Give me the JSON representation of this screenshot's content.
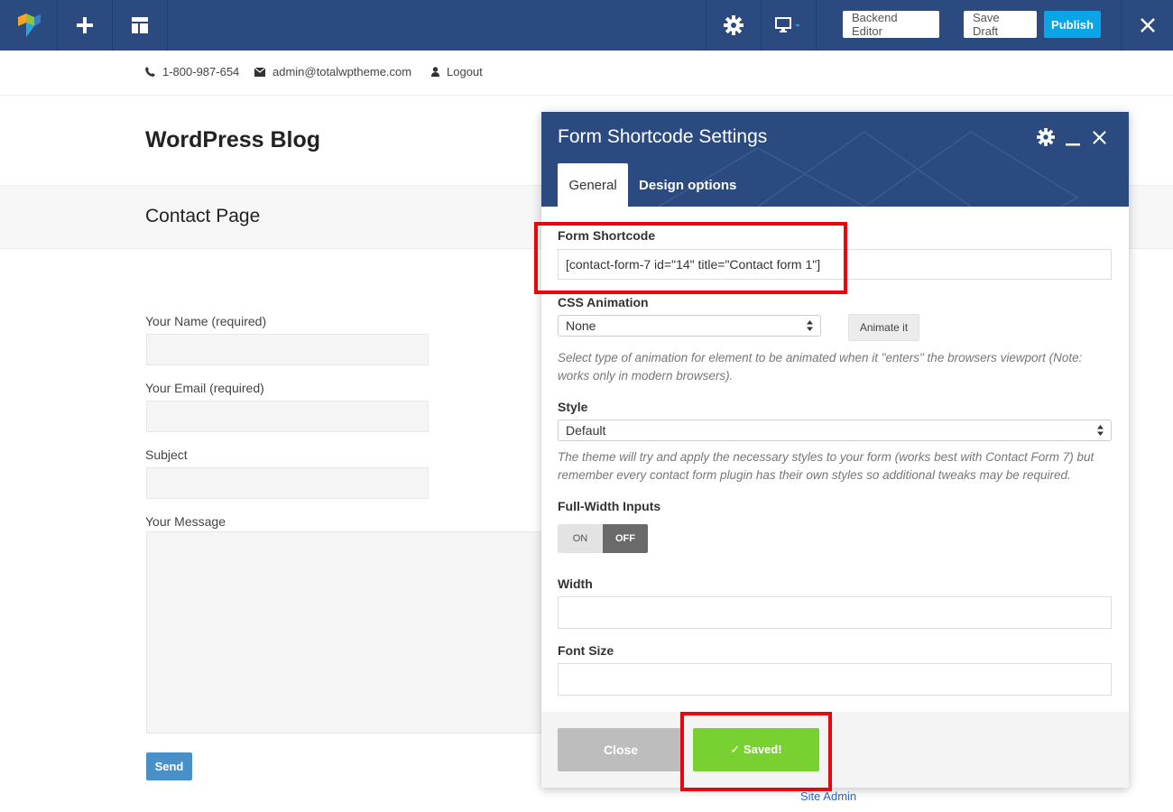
{
  "toolbar": {
    "logo_icon": "visual-composer-logo-icon",
    "add_icon": "plus-icon",
    "templates_icon": "layout-icon",
    "settings_icon": "gear-icon",
    "responsive_icon": "monitor-icon",
    "backend_editor_label": "Backend Editor",
    "save_draft_label": "Save Draft",
    "publish_label": "Publish",
    "close_icon": "close-icon"
  },
  "info_bar": {
    "phone": "1-800-987-654",
    "email": "admin@totalwptheme.com",
    "logout": "Logout"
  },
  "site": {
    "title": "WordPress Blog",
    "page_title": "Contact Page"
  },
  "contact_form": {
    "name_label": "Your Name (required)",
    "email_label": "Your Email (required)",
    "subject_label": "Subject",
    "message_label": "Your Message",
    "send_label": "Send"
  },
  "site_admin_link": "Site Admin",
  "modal": {
    "title": "Form Shortcode Settings",
    "tabs": [
      {
        "label": "General",
        "active": true
      },
      {
        "label": "Design options",
        "active": false
      }
    ],
    "fields": {
      "form_shortcode_label": "Form Shortcode",
      "form_shortcode_value": "[contact-form-7 id=\"14\" title=\"Contact form 1\"]",
      "css_animation_label": "CSS Animation",
      "css_animation_value": "None",
      "animate_button": "Animate it",
      "css_animation_help": "Select type of animation for element to be animated when it \"enters\" the browsers viewport (Note: works only in modern browsers).",
      "style_label": "Style",
      "style_value": "Default",
      "style_help": "The theme will try and apply the necessary styles to your form (works best with Contact Form 7) but remember every contact form plugin has their own styles so additional tweaks may be required.",
      "full_width_label": "Full-Width Inputs",
      "toggle_on": "ON",
      "toggle_off": "OFF",
      "width_label": "Width",
      "width_value": "",
      "font_size_label": "Font Size",
      "font_size_value": ""
    },
    "close_label": "Close",
    "saved_label": "✓ Saved!"
  },
  "colors": {
    "toolbar_bg": "#2b4b80",
    "publish_bg": "#0aa5e6",
    "saved_bg": "#79d131",
    "highlight": "#e8050d"
  }
}
